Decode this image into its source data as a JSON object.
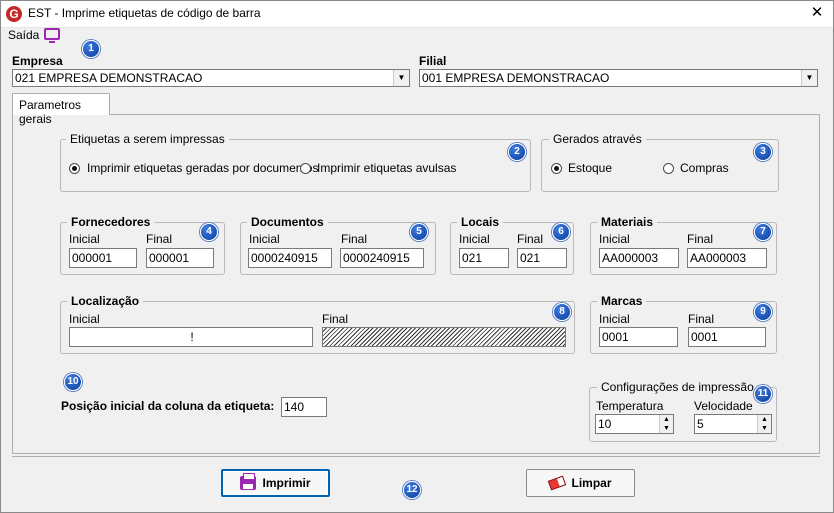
{
  "window": {
    "title": "EST - Imprime etiquetas de código de barra",
    "close": "✕",
    "app_icon": "G"
  },
  "menu": {
    "saida": "Saída"
  },
  "empresa": {
    "label": "Empresa",
    "value": "021 EMPRESA DEMONSTRACAO"
  },
  "filial": {
    "label": "Filial",
    "value": "001 EMPRESA DEMONSTRACAO"
  },
  "tabs": [
    {
      "label": "Parametros gerais"
    }
  ],
  "etiquetas": {
    "title": "Etiquetas a serem impressas",
    "opt_documentos": "Imprimir etiquetas geradas por documentos",
    "opt_avulsas": "Imprimir etiquetas avulsas",
    "selected": "documentos"
  },
  "gerados": {
    "title": "Gerados através",
    "opt_estoque": "Estoque",
    "opt_compras": "Compras",
    "selected": "estoque"
  },
  "fornecedores": {
    "title": "Fornecedores",
    "inicial_label": "Inicial",
    "final_label": "Final",
    "inicial": "000001",
    "final": "000001"
  },
  "documentos": {
    "title": "Documentos",
    "inicial_label": "Inicial",
    "final_label": "Final",
    "inicial": "0000240915",
    "final": "0000240915"
  },
  "locais": {
    "title": "Locais",
    "inicial_label": "Inicial",
    "final_label": "Final",
    "inicial": "021",
    "final": "021"
  },
  "materiais": {
    "title": "Materiais",
    "inicial_label": "Inicial",
    "final_label": "Final",
    "inicial": "AA000003",
    "final": "AA000003"
  },
  "localizacao": {
    "title": "Localização",
    "inicial_label": "Inicial",
    "final_label": "Final",
    "inicial": "!",
    "final": ""
  },
  "marcas": {
    "title": "Marcas",
    "inicial_label": "Inicial",
    "final_label": "Final",
    "inicial": "0001",
    "final": "0001"
  },
  "posicao": {
    "label": "Posição inicial da coluna da etiqueta:",
    "value": "140"
  },
  "config": {
    "title": "Configurações de impressão",
    "temp_label": "Temperatura",
    "temp_value": "10",
    "vel_label": "Velocidade",
    "vel_value": "5"
  },
  "buttons": {
    "imprimir": "Imprimir",
    "limpar": "Limpar"
  },
  "badges": [
    "1",
    "2",
    "3",
    "4",
    "5",
    "6",
    "7",
    "8",
    "9",
    "10",
    "11",
    "12"
  ],
  "colors": {
    "badge": "#1f5bc4",
    "accent": "#9c27b0",
    "default_button": "#0063b1"
  }
}
